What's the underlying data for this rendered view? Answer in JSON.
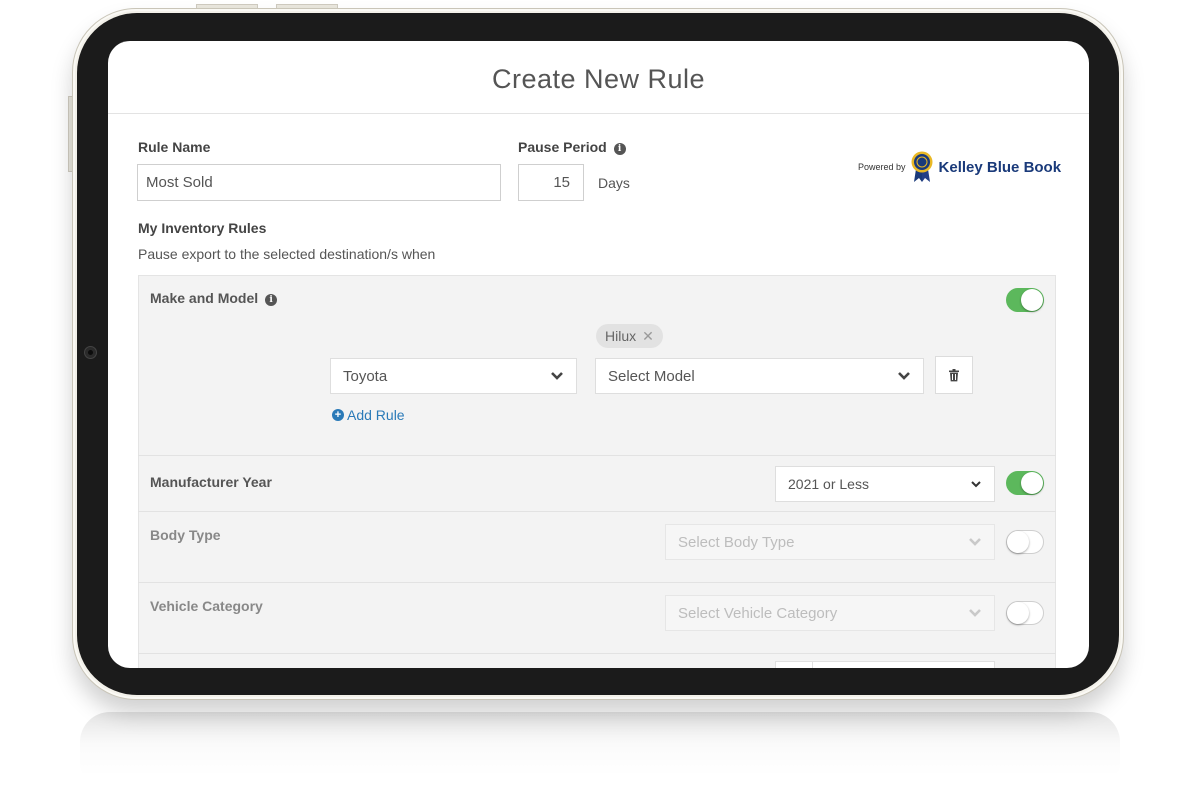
{
  "modal": {
    "title": "Create New Rule"
  },
  "form": {
    "rule_name_label": "Rule Name",
    "rule_name_value": "Most Sold",
    "pause_period_label": "Pause Period",
    "pause_period_value": "15",
    "pause_period_unit": "Days",
    "inventory_rules_heading": "My Inventory Rules",
    "inventory_rules_subtext": "Pause export to the selected destination/s when"
  },
  "branding": {
    "powered_by": "Powered by",
    "name": "Kelley Blue Book"
  },
  "rules": {
    "make_model": {
      "label": "Make and Model",
      "enabled": true,
      "selected_model_tag": "Hilux",
      "make_value": "Toyota",
      "model_placeholder": "Select Model",
      "add_rule_label": "Add Rule"
    },
    "manufacturer_year": {
      "label": "Manufacturer Year",
      "enabled": true,
      "value": "2021 or Less"
    },
    "body_type": {
      "label": "Body Type",
      "enabled": false,
      "placeholder": "Select Body Type"
    },
    "vehicle_category": {
      "label": "Vehicle Category",
      "enabled": false,
      "placeholder": "Select Vehicle Category"
    }
  },
  "colors": {
    "toggle_on": "#5cb85c",
    "link": "#2a7ab8",
    "brand": "#1a3a7a"
  }
}
